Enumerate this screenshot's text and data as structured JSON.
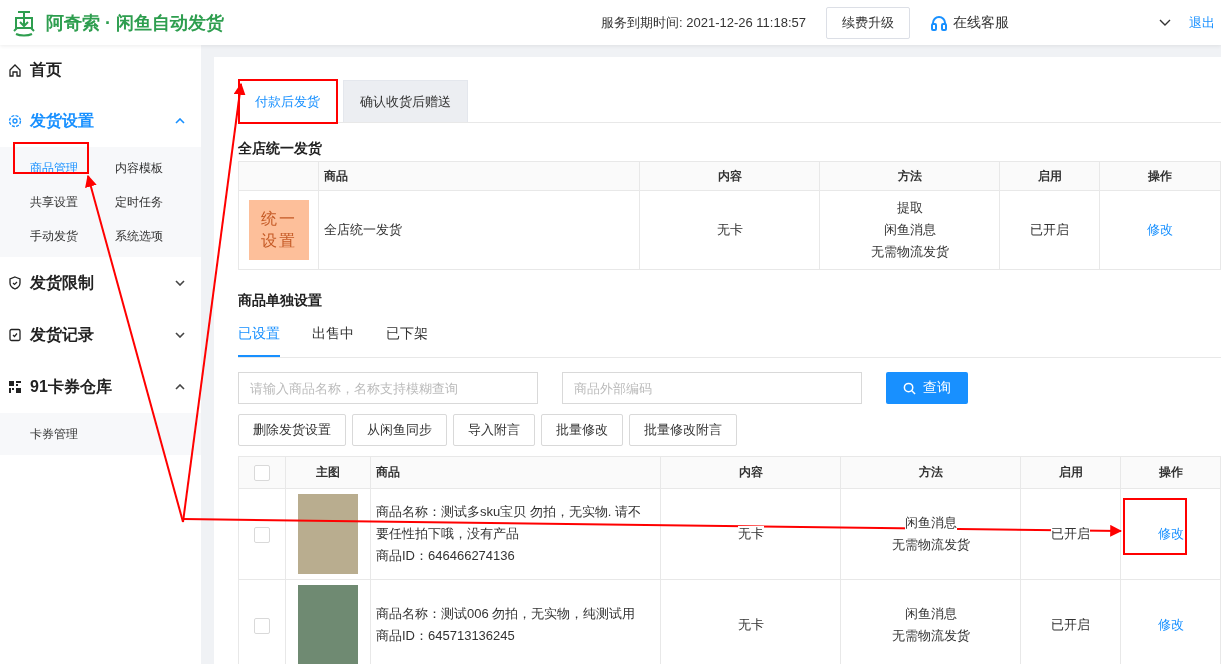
{
  "header": {
    "brand": "阿奇索 · 闲鱼自动发货",
    "expiry": "服务到期时间: 2021-12-26 11:18:57",
    "upgrade_button": "续费升级",
    "support_link": "在线客服",
    "logout_link": "退出"
  },
  "sidebar": {
    "items": [
      {
        "kind": "link",
        "label": "首页",
        "selected": false
      },
      {
        "kind": "group",
        "label": "发货设置",
        "expanded": true,
        "selected": true,
        "children": [
          {
            "label": "商品管理",
            "selected": true
          },
          {
            "label": "内容模板",
            "selected": false
          },
          {
            "label": "共享设置",
            "selected": false
          },
          {
            "label": "定时任务",
            "selected": false
          },
          {
            "label": "手动发货",
            "selected": false
          },
          {
            "label": "系统选项",
            "selected": false
          }
        ]
      },
      {
        "kind": "group",
        "label": "发货限制",
        "expanded": false,
        "selected": false
      },
      {
        "kind": "group",
        "label": "发货记录",
        "expanded": false,
        "selected": false
      },
      {
        "kind": "group",
        "label": "91卡券仓库",
        "expanded": true,
        "selected": false,
        "children": [
          {
            "label": "卡券管理",
            "selected": false
          }
        ]
      }
    ]
  },
  "main": {
    "tabs": [
      {
        "label": "付款后发货",
        "selected": true
      },
      {
        "label": "确认收货后赠送",
        "selected": false
      }
    ],
    "store_section": {
      "title": "全店统一发货",
      "columns": [
        "商品",
        "内容",
        "方法",
        "启用",
        "操作"
      ],
      "rows": [
        {
          "thumb_lines": [
            "统一",
            "设置"
          ],
          "product": "全店统一发货",
          "content": "无卡",
          "methods": [
            "提取",
            "闲鱼消息",
            "无需物流发货"
          ],
          "status": "已开启",
          "action": "修改"
        }
      ]
    },
    "item_section": {
      "title": "商品单独设置",
      "tabs": [
        {
          "label": "已设置",
          "selected": true
        },
        {
          "label": "出售中",
          "selected": false
        },
        {
          "label": "已下架",
          "selected": false
        }
      ],
      "search": [
        {
          "placeholder": "请输入商品名称，名称支持模糊查询"
        },
        {
          "placeholder": "商品外部编码"
        }
      ],
      "search_button": "查询",
      "actions": [
        "删除发货设置",
        "从闲鱼同步",
        "导入附言",
        "批量修改",
        "批量修改附言"
      ],
      "columns": [
        "主图",
        "商品",
        "内容",
        "方法",
        "启用",
        "操作"
      ],
      "header_checked": false,
      "rows": [
        {
          "checked": false,
          "name": "商品名称：测试多sku宝贝 勿拍，无实物. 请不要任性拍下哦，没有产品",
          "id": "商品ID：646466274136",
          "content": "无卡",
          "methods": [
            "闲鱼消息",
            "无需物流发货"
          ],
          "status": "已开启",
          "action": "修改"
        },
        {
          "checked": false,
          "name": "商品名称：测试006 勿拍，无实物，纯测试用",
          "id": "商品ID：645713136245",
          "content": "无卡",
          "methods": [
            "闲鱼消息",
            "无需物流发货"
          ],
          "status": "已开启",
          "action": "修改"
        }
      ]
    }
  }
}
